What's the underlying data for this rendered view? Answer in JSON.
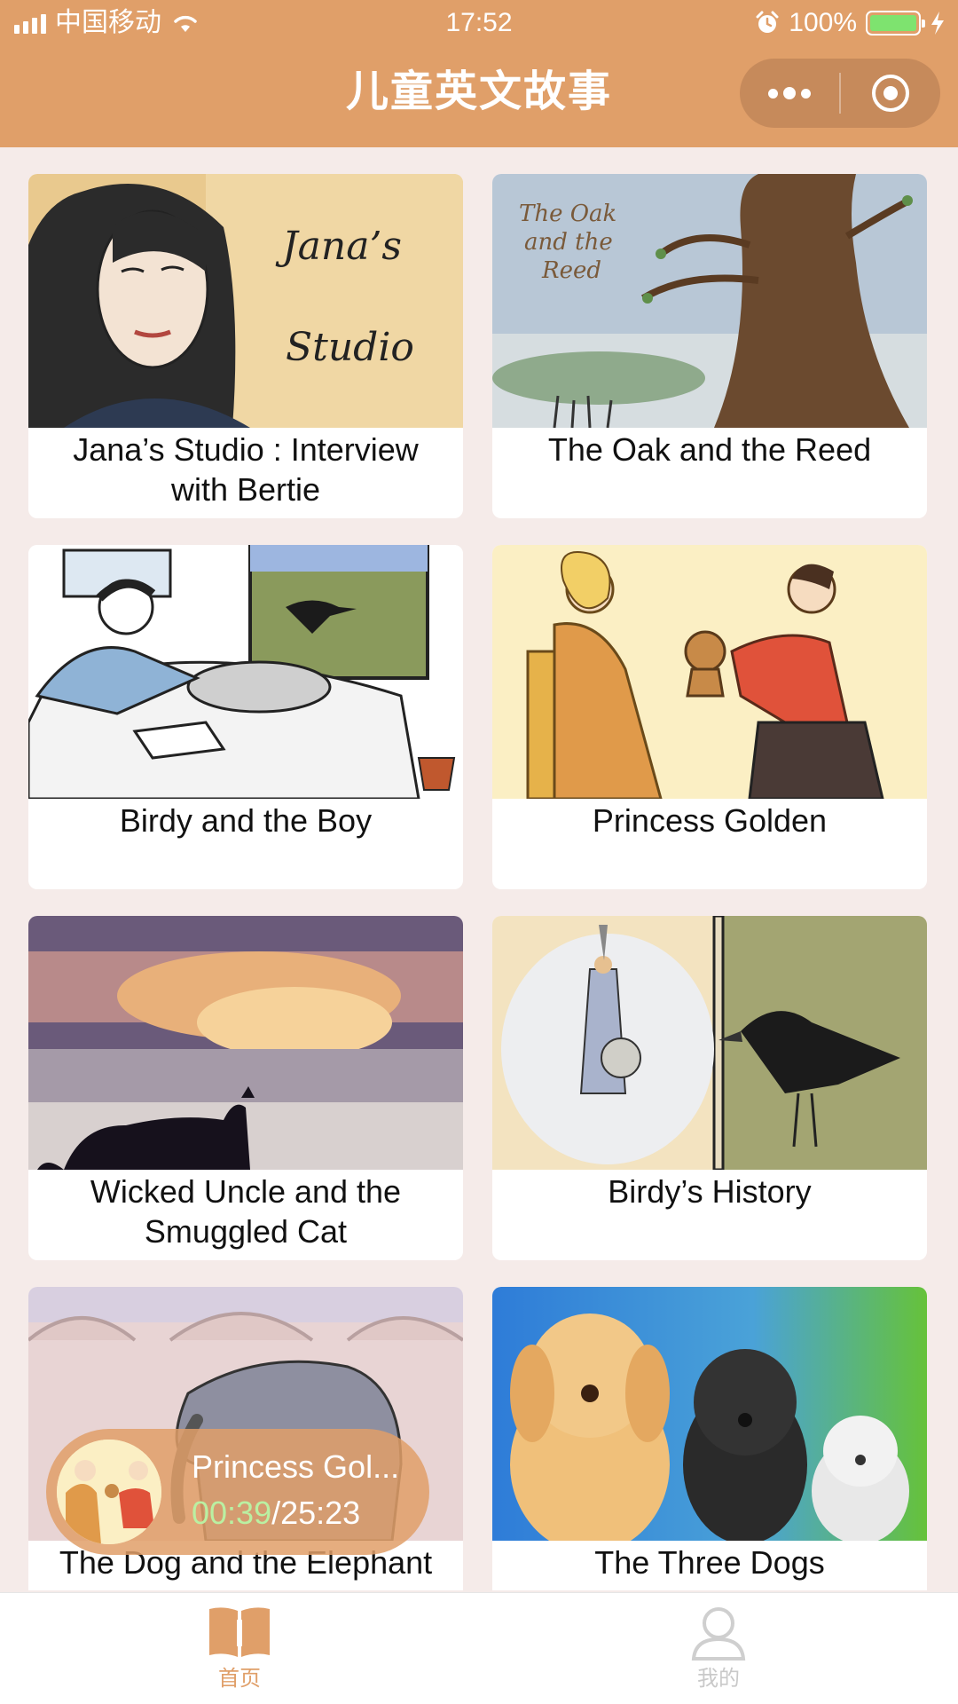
{
  "status_bar": {
    "carrier": "中国移动",
    "time": "17:52",
    "battery": "100%"
  },
  "nav": {
    "title": "儿童英文故事"
  },
  "stories": [
    {
      "title": "Jana’s Studio : Interview with Bertie"
    },
    {
      "title": "The Oak and the Reed"
    },
    {
      "title": "Birdy and the Boy"
    },
    {
      "title": "Princess Golden"
    },
    {
      "title": "Wicked Uncle and the Smuggled Cat"
    },
    {
      "title": "Birdy’s History"
    },
    {
      "title": "The Dog and the Elephant"
    },
    {
      "title": "The Three Dogs"
    }
  ],
  "thumb_text": {
    "jana_line1": "Jana’s",
    "jana_line2": "Studio",
    "oak_line1": "The Oak",
    "oak_line2": "and the",
    "oak_line3": "Reed"
  },
  "player": {
    "title": "Princess Gol...",
    "current_time": "00:39",
    "total_time": "/25:23"
  },
  "tabs": [
    {
      "label": "首页",
      "icon": "book-icon",
      "active": true
    },
    {
      "label": "我的",
      "icon": "person-icon",
      "active": false
    }
  ],
  "colors": {
    "accent": "#e09f69",
    "background": "#f5ebe9",
    "progress_time": "#baf0a2"
  }
}
